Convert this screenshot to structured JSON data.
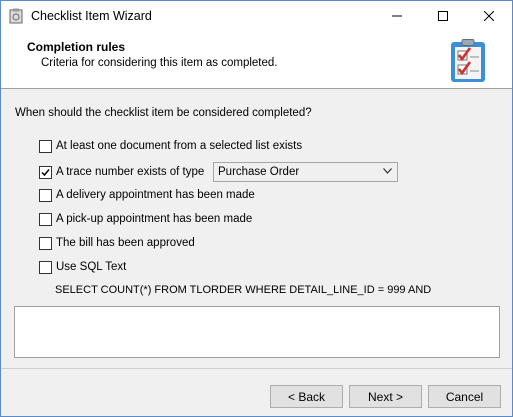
{
  "window": {
    "title": "Checklist Item Wizard"
  },
  "header": {
    "title": "Completion rules",
    "subtitle": "Criteria for considering this item as completed."
  },
  "question": "When should the checklist item be considered completed?",
  "options": [
    {
      "label": "At least one document from a selected list exists",
      "checked": false
    },
    {
      "label": "A trace number exists of type",
      "checked": true
    },
    {
      "label": "A delivery appointment has been made",
      "checked": false
    },
    {
      "label": "A pick-up appointment has been made",
      "checked": false
    },
    {
      "label": "The bill has been approved",
      "checked": false
    },
    {
      "label": "Use SQL Text",
      "checked": false
    }
  ],
  "trace_type": {
    "selected": "Purchase Order"
  },
  "sql_preview": "SELECT COUNT(*) FROM TLORDER WHERE DETAIL_LINE_ID = 999 AND",
  "sql_text": "",
  "buttons": {
    "back": "< Back",
    "next": "Next >",
    "cancel": "Cancel"
  },
  "colors": {
    "window_border": "#5a8bc8",
    "icon_clipboard": "#3c8fd6",
    "icon_check": "#d0312d"
  }
}
